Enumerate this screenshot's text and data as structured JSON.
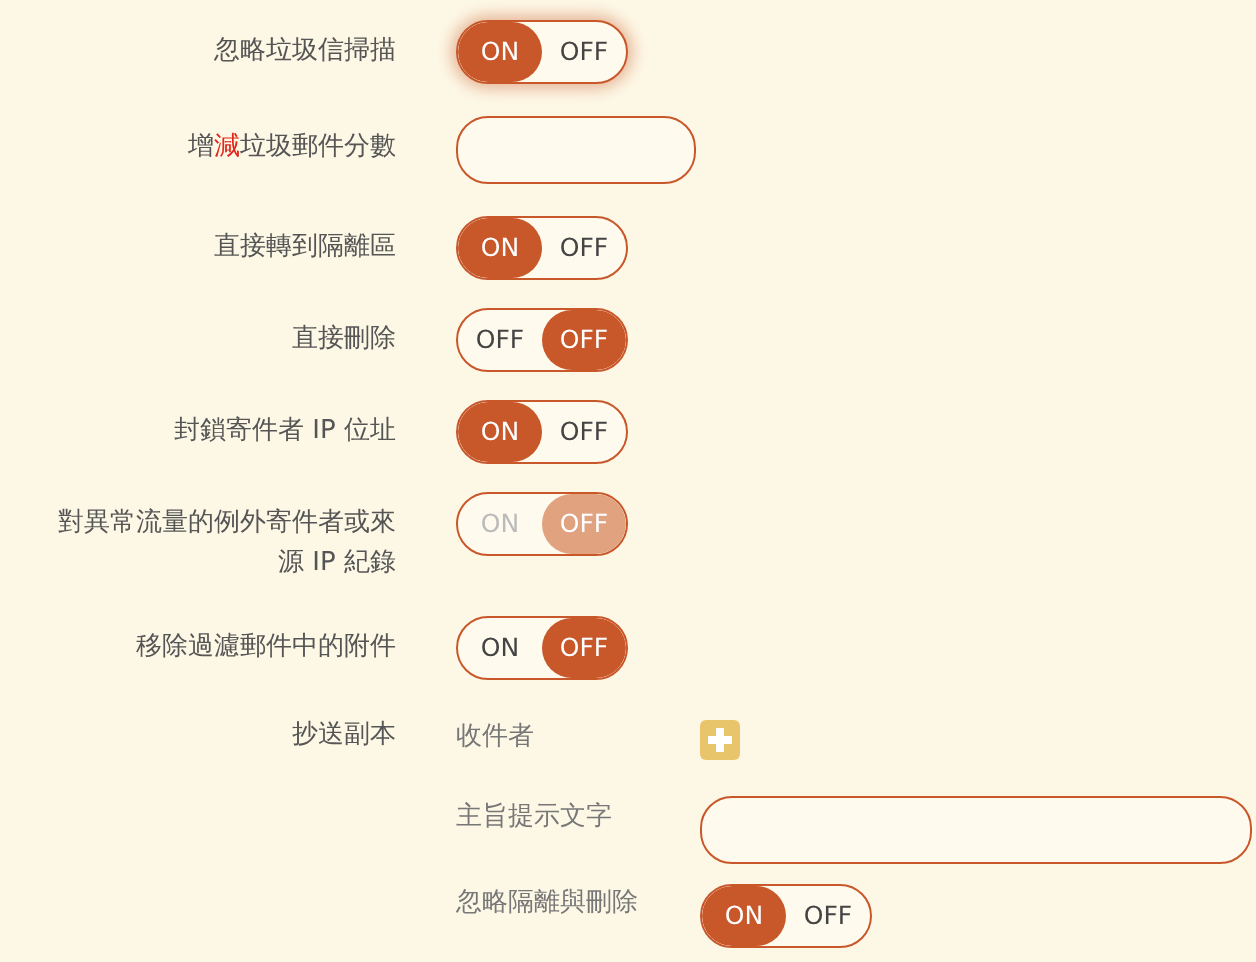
{
  "rows": [
    {
      "kind": "toggle",
      "label": "忽略垃圾信掃描",
      "on_text": "ON",
      "off_text": "OFF",
      "on": true,
      "disabled": false,
      "focused": true
    },
    {
      "kind": "field",
      "label": "增**減**垃圾郵件分數"
    },
    {
      "kind": "toggle",
      "label": "直接轉到隔離區",
      "on_text": "ON",
      "off_text": "OFF",
      "on": true,
      "disabled": false,
      "focused": false
    },
    {
      "kind": "toggle",
      "label": "直接刪除",
      "on_text": "OFF",
      "off_text": "OFF",
      "on": false,
      "disabled": false,
      "focused": false
    },
    {
      "kind": "toggle",
      "label": "封鎖寄件者 IP 位址",
      "on_text": "ON",
      "off_text": "OFF",
      "on": true,
      "disabled": false,
      "focused": false
    },
    {
      "kind": "toggle",
      "label": "對異常流量的例外寄件者或來源 IP 紀錄",
      "on_text": "ON",
      "off_text": "OFF",
      "on": false,
      "disabled": true,
      "focused": false
    },
    {
      "kind": "toggle",
      "label": "移除過濾郵件中的附件",
      "on_text": "ON",
      "off_text": "OFF",
      "on": false,
      "disabled": false,
      "focused": false
    },
    {
      "kind": "cc",
      "label": "抄送副本",
      "recipients_label": "收件者",
      "subject_label": "主旨提示文字",
      "ignore": {
        "label": "忽略隔離與刪除",
        "on_text": "ON",
        "off_text": "OFF",
        "on": true,
        "disabled": false,
        "focused": false
      }
    }
  ]
}
